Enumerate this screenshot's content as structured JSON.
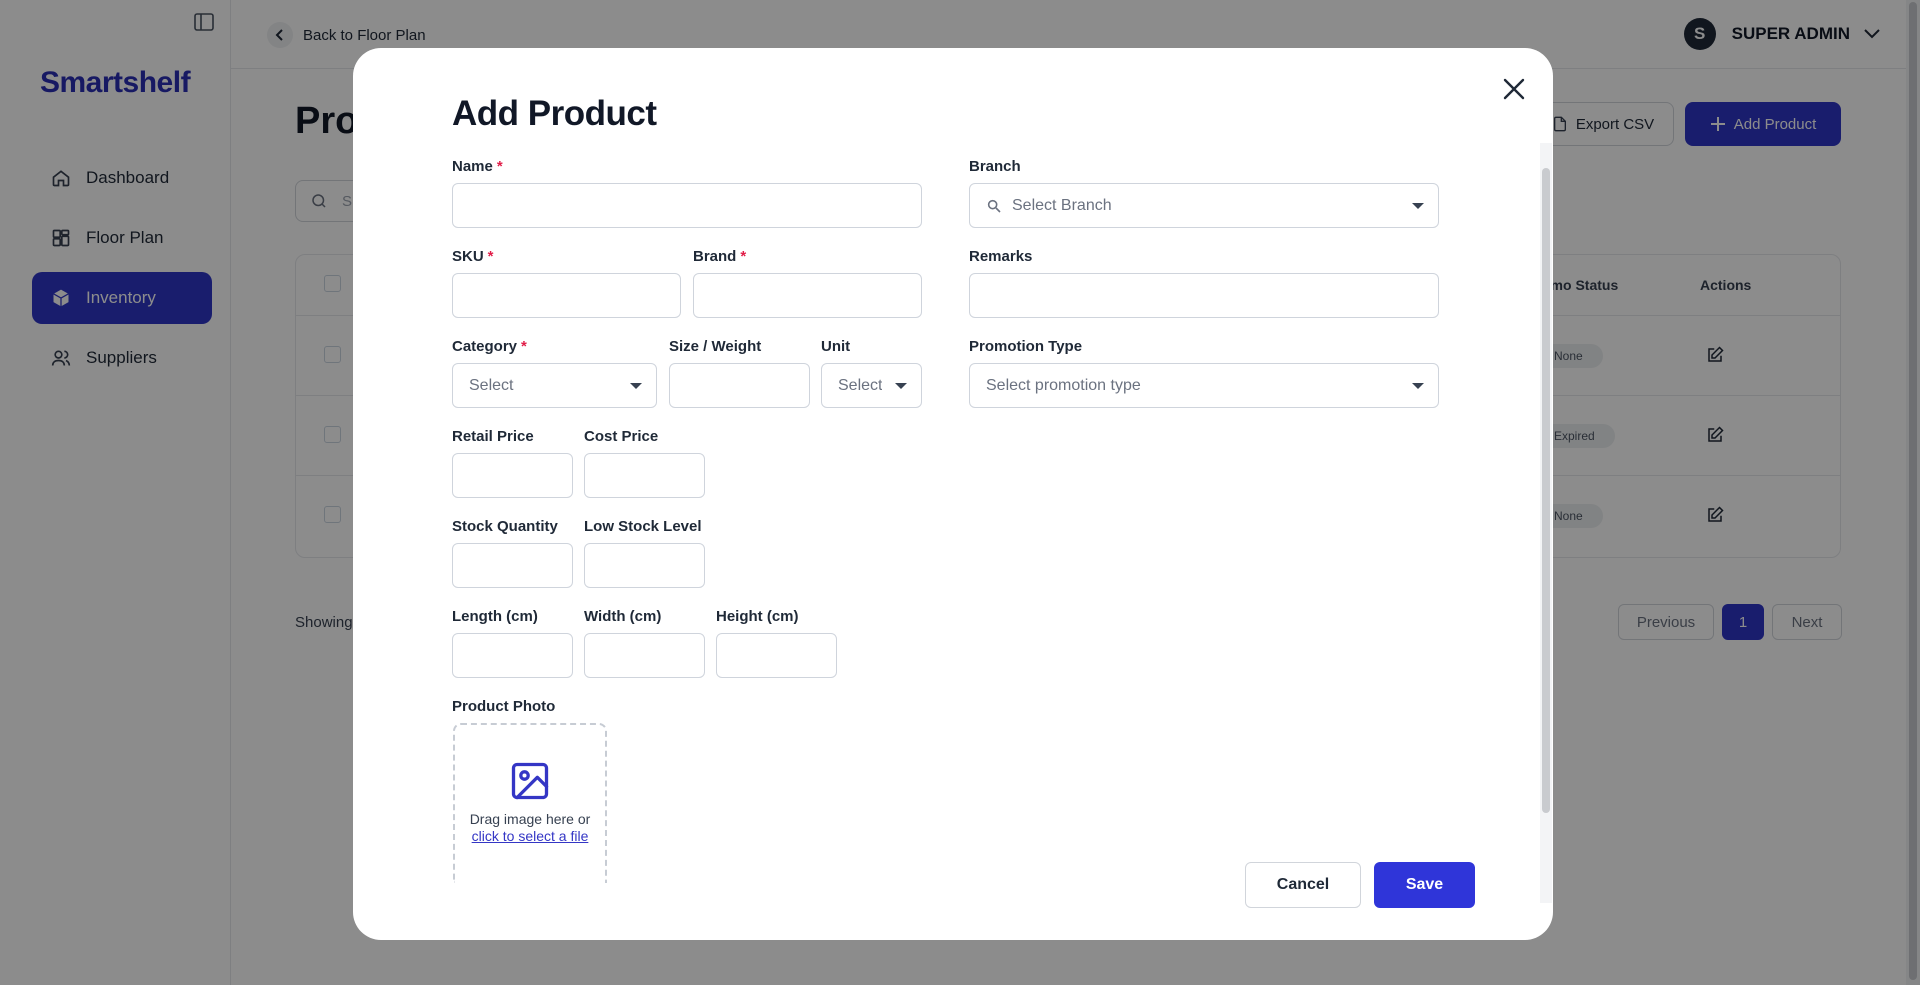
{
  "app": {
    "brand": "Smartshelf",
    "back_label": "Back to Floor Plan",
    "user": {
      "initial": "S",
      "name": "SUPER ADMIN"
    },
    "accent_color": "#2f35c7"
  },
  "sidebar": {
    "items": [
      {
        "label": "Dashboard",
        "icon": "home-icon",
        "active": false
      },
      {
        "label": "Floor Plan",
        "icon": "layout-icon",
        "active": false
      },
      {
        "label": "Inventory",
        "icon": "box-icon",
        "active": true
      },
      {
        "label": "Suppliers",
        "icon": "users-icon",
        "active": false
      }
    ]
  },
  "page": {
    "title_visible": "Pro",
    "search_placeholder_visible": "S",
    "export_label": "Export CSV",
    "add_label": "Add Product",
    "table": {
      "headers": {
        "promo_status_visible": "omo Status",
        "actions": "Actions"
      },
      "rows": [
        {
          "promo_status": "None"
        },
        {
          "promo_status": "Expired"
        },
        {
          "promo_status": "None"
        }
      ]
    },
    "showing_visible": "Showing",
    "pagination": {
      "previous": "Previous",
      "current": "1",
      "next": "Next"
    }
  },
  "modal": {
    "title": "Add Product",
    "fields": {
      "name": {
        "label": "Name",
        "required": "*",
        "value": ""
      },
      "sku": {
        "label": "SKU",
        "required": "*",
        "value": ""
      },
      "brand": {
        "label": "Brand",
        "required": "*",
        "value": ""
      },
      "category": {
        "label": "Category",
        "required": "*",
        "placeholder": "Select"
      },
      "size_weight": {
        "label": "Size / Weight",
        "value": ""
      },
      "unit": {
        "label": "Unit",
        "placeholder": "Select"
      },
      "retail_price": {
        "label": "Retail Price",
        "value": ""
      },
      "cost_price": {
        "label": "Cost Price",
        "value": ""
      },
      "stock_quantity": {
        "label": "Stock Quantity",
        "value": ""
      },
      "low_stock_level": {
        "label": "Low Stock Level",
        "value": ""
      },
      "length": {
        "label": "Length (cm)",
        "value": ""
      },
      "width": {
        "label": "Width (cm)",
        "value": ""
      },
      "height": {
        "label": "Height (cm)",
        "value": ""
      },
      "branch": {
        "label": "Branch",
        "placeholder": "Select Branch"
      },
      "remarks": {
        "label": "Remarks",
        "value": ""
      },
      "promotion_type": {
        "label": "Promotion Type",
        "placeholder": "Select promotion type"
      },
      "product_photo": {
        "label": "Product Photo",
        "drop_text": "Drag image here or",
        "link_text": "click to select a file"
      }
    },
    "cancel_label": "Cancel",
    "save_label": "Save"
  }
}
